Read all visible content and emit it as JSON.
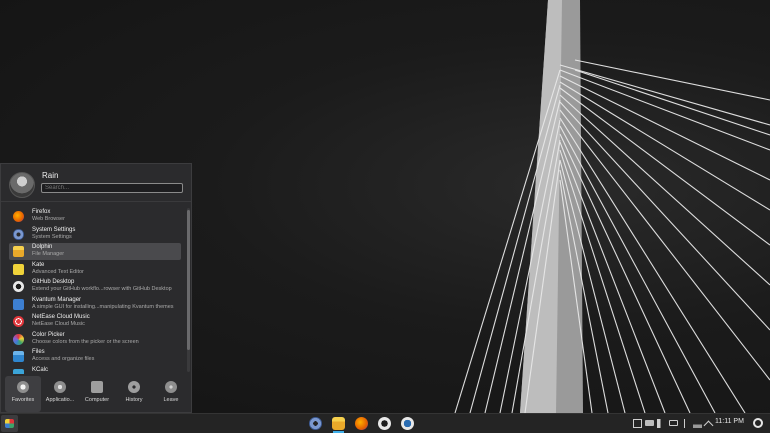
{
  "user": {
    "name": "Rain"
  },
  "search": {
    "placeholder": "Search..."
  },
  "apps": [
    {
      "name": "Firefox",
      "desc": "Web Browser",
      "icon": "firefox-icon",
      "color": "#e66000"
    },
    {
      "name": "System Settings",
      "desc": "System Settings",
      "icon": "settings-icon",
      "color": "#5c7dbd"
    },
    {
      "name": "Dolphin",
      "desc": "File Manager",
      "icon": "folder-icon",
      "color": "#f3c23c"
    },
    {
      "name": "Kate",
      "desc": "Advanced Text Editor",
      "icon": "kate-icon",
      "color": "#f0d33a"
    },
    {
      "name": "GitHub Desktop",
      "desc": "Extend your GitHub workflo...rowser with GitHub Desktop",
      "icon": "github-icon",
      "color": "#e8e8e8"
    },
    {
      "name": "Kvantum Manager",
      "desc": "A simple GUI for installing...manipulating Kvantum themes",
      "icon": "kvantum-icon",
      "color": "#3d7fd1"
    },
    {
      "name": "NetEase Cloud Music",
      "desc": "NetEase Cloud Music",
      "icon": "netease-icon",
      "color": "#e0353a"
    },
    {
      "name": "Color Picker",
      "desc": "Choose colors from the picker or the screen",
      "icon": "color-picker-icon",
      "color": "#8a5fd1"
    },
    {
      "name": "Files",
      "desc": "Access and organize files",
      "icon": "files-icon",
      "color": "#3e9ae0"
    },
    {
      "name": "KCalc",
      "desc": "",
      "icon": "calculator-icon",
      "color": "#3ba4d8"
    }
  ],
  "tabs": [
    {
      "label": "Favorites",
      "icon": "star-icon"
    },
    {
      "label": "Applicatio...",
      "icon": "grid-icon"
    },
    {
      "label": "Computer",
      "icon": "computer-icon"
    },
    {
      "label": "History",
      "icon": "clock-icon"
    },
    {
      "label": "Leave",
      "icon": "arrow-icon"
    }
  ],
  "clock": {
    "time": "11:11 PM"
  },
  "colors": {
    "accent": "#3daee9",
    "panel": "#2b2b2d",
    "taskbar": "#242424"
  }
}
